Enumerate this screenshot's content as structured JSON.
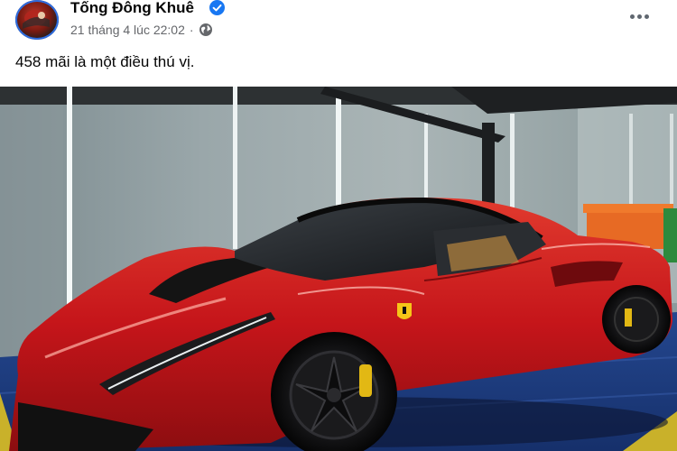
{
  "post": {
    "author_name": "Tống Đông Khuê",
    "timestamp": "21 tháng 4 lúc 22:02",
    "separator": "·",
    "caption": "458 mãi là một điều thú vị."
  },
  "colors": {
    "verified": "#1877f2",
    "meta_text": "#65676b",
    "car_red": "#c8141a",
    "floor_blue": "#1d3f8a"
  },
  "icons": {
    "verified": "verified-badge-icon",
    "audience": "globe-icon",
    "more": "more-options-icon"
  }
}
